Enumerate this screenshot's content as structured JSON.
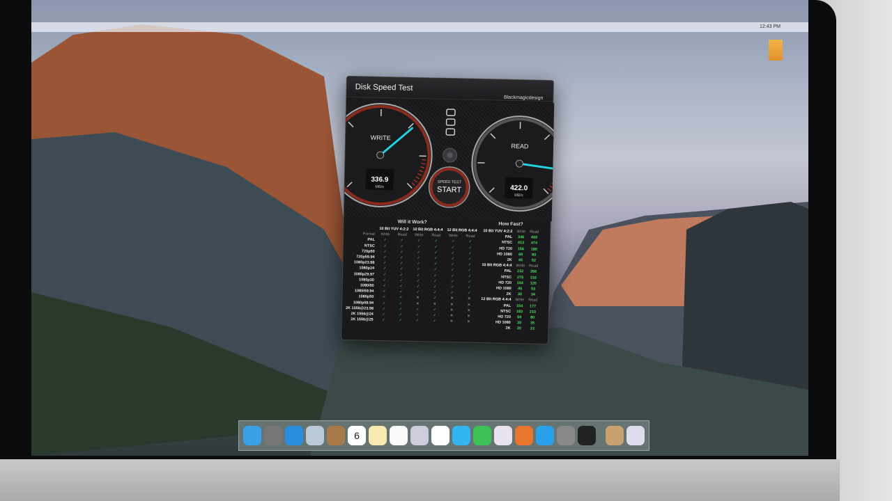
{
  "menubar": {
    "clock": "12:43 PM"
  },
  "window": {
    "title": "Disk Speed Test",
    "brand": "Blackmagicdesign"
  },
  "write_gauge": {
    "label": "WRITE",
    "value": "336.9",
    "unit": "MB/s",
    "fraction": 0.68
  },
  "read_gauge": {
    "label": "READ",
    "value": "422.0",
    "unit": "MB/s",
    "fraction": 0.86
  },
  "start_button": {
    "top": "SPEED TEST",
    "label": "START"
  },
  "will_it_work": {
    "title": "Will it Work?",
    "groups": [
      "10 Bit YUV 4:2:2",
      "10 Bit RGB 4:4:4",
      "12 Bit RGB 4:4:4"
    ],
    "format_header": "Format",
    "write": "Write",
    "read": "Read",
    "rows": [
      {
        "format": "PAL",
        "marks": [
          1,
          1,
          1,
          1,
          1,
          1
        ]
      },
      {
        "format": "NTSC",
        "marks": [
          1,
          1,
          1,
          1,
          1,
          1
        ]
      },
      {
        "format": "720p50",
        "marks": [
          1,
          1,
          1,
          1,
          1,
          1
        ]
      },
      {
        "format": "720p59.94",
        "marks": [
          1,
          1,
          1,
          1,
          1,
          1
        ]
      },
      {
        "format": "1080p23.98",
        "marks": [
          1,
          1,
          1,
          1,
          1,
          1
        ]
      },
      {
        "format": "1080p24",
        "marks": [
          1,
          1,
          1,
          1,
          1,
          1
        ]
      },
      {
        "format": "1080p29.97",
        "marks": [
          1,
          1,
          1,
          1,
          1,
          1
        ]
      },
      {
        "format": "1080p30",
        "marks": [
          1,
          1,
          1,
          1,
          1,
          1
        ]
      },
      {
        "format": "1080i50",
        "marks": [
          1,
          1,
          1,
          1,
          1,
          1
        ]
      },
      {
        "format": "1080i59.94",
        "marks": [
          1,
          1,
          1,
          1,
          1,
          1
        ]
      },
      {
        "format": "1080p50",
        "marks": [
          1,
          1,
          0,
          1,
          0,
          0
        ]
      },
      {
        "format": "1080p59.94",
        "marks": [
          1,
          1,
          0,
          0,
          0,
          0
        ]
      },
      {
        "format": "2K 1556@23.98",
        "marks": [
          1,
          1,
          1,
          1,
          0,
          0
        ]
      },
      {
        "format": "2K 1556@24",
        "marks": [
          1,
          1,
          1,
          1,
          0,
          0
        ]
      },
      {
        "format": "2K 1556@25",
        "marks": [
          1,
          1,
          1,
          1,
          0,
          0
        ]
      }
    ]
  },
  "how_fast": {
    "title": "How Fast?",
    "write": "Write",
    "read": "Read",
    "sections": [
      {
        "name": "10 Bit YUV 4:2:2",
        "rows": [
          [
            "PAL",
            "346",
            "400"
          ],
          [
            "NTSC",
            "413",
            "474"
          ],
          [
            "HD 720",
            "156",
            "180"
          ],
          [
            "HD 1080",
            "69",
            "80"
          ],
          [
            "2K",
            "45",
            "52"
          ]
        ]
      },
      {
        "name": "10 Bit RGB 4:4:4",
        "rows": [
          [
            "PAL",
            "232",
            "266"
          ],
          [
            "NTSC",
            "275",
            "316"
          ],
          [
            "HD 720",
            "104",
            "120"
          ],
          [
            "HD 1080",
            "46",
            "53"
          ],
          [
            "2K",
            "30",
            "34"
          ]
        ]
      },
      {
        "name": "12 Bit RGB 4:4:4",
        "rows": [
          [
            "PAL",
            "154",
            "177"
          ],
          [
            "NTSC",
            "183",
            "210"
          ],
          [
            "HD 720",
            "69",
            "80"
          ],
          [
            "HD 1080",
            "30",
            "35"
          ],
          [
            "2K",
            "20",
            "23"
          ]
        ]
      }
    ]
  },
  "dock": {
    "calendar_day": "6",
    "apps": [
      "finder",
      "launchpad",
      "safari",
      "preview",
      "contacts",
      "calendar",
      "notes",
      "reminders",
      "photo-booth",
      "photos",
      "messages",
      "facetime",
      "itunes",
      "ibooks",
      "app-store",
      "system-preferences",
      "disk-speed-test",
      "downloads",
      "trash"
    ]
  },
  "colors": {
    "accent": "#22d3df",
    "ok": "#3fd34a",
    "red": "#c8351f"
  }
}
